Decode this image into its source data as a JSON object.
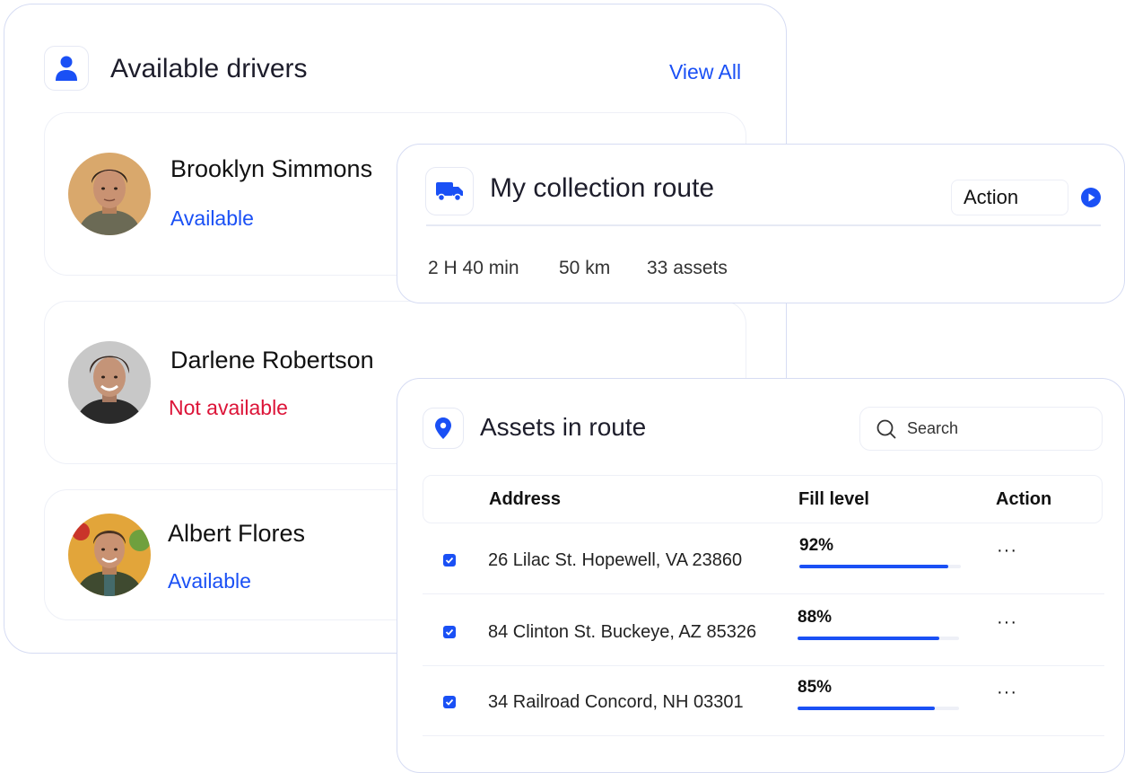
{
  "drivers": {
    "title": "Available drivers",
    "view_all": "View All",
    "icon": "user-icon",
    "items": [
      {
        "name": "Brooklyn Simmons",
        "status": "Available",
        "status_type": "available"
      },
      {
        "name": "Darlene Robertson",
        "status": "Not available",
        "status_type": "not-available"
      },
      {
        "name": "Albert Flores",
        "status": "Available",
        "status_type": "available"
      }
    ]
  },
  "route": {
    "title": "My collection route",
    "icon": "truck-icon",
    "action_label": "Action",
    "stats": {
      "duration": "2 H 40 min",
      "distance": "50 km",
      "assets": "33 assets"
    }
  },
  "assets": {
    "title": "Assets in route",
    "icon": "location-pin-icon",
    "search_placeholder": "Search",
    "columns": {
      "address": "Address",
      "fill": "Fill level",
      "action": "Action"
    },
    "rows": [
      {
        "address": "26 Lilac St. Hopewell, VA 23860",
        "fill_label": "92%",
        "fill": 92,
        "checked": true,
        "action": "···"
      },
      {
        "address": "84 Clinton St. Buckeye, AZ 85326",
        "fill_label": "88%",
        "fill": 88,
        "checked": true,
        "action": "···"
      },
      {
        "address": "34 Railroad Concord, NH 03301",
        "fill_label": "85%",
        "fill": 85,
        "checked": true,
        "action": "···"
      }
    ]
  },
  "colors": {
    "accent": "#1a50f5",
    "danger": "#dc1438",
    "border": "#d6dcf3"
  }
}
